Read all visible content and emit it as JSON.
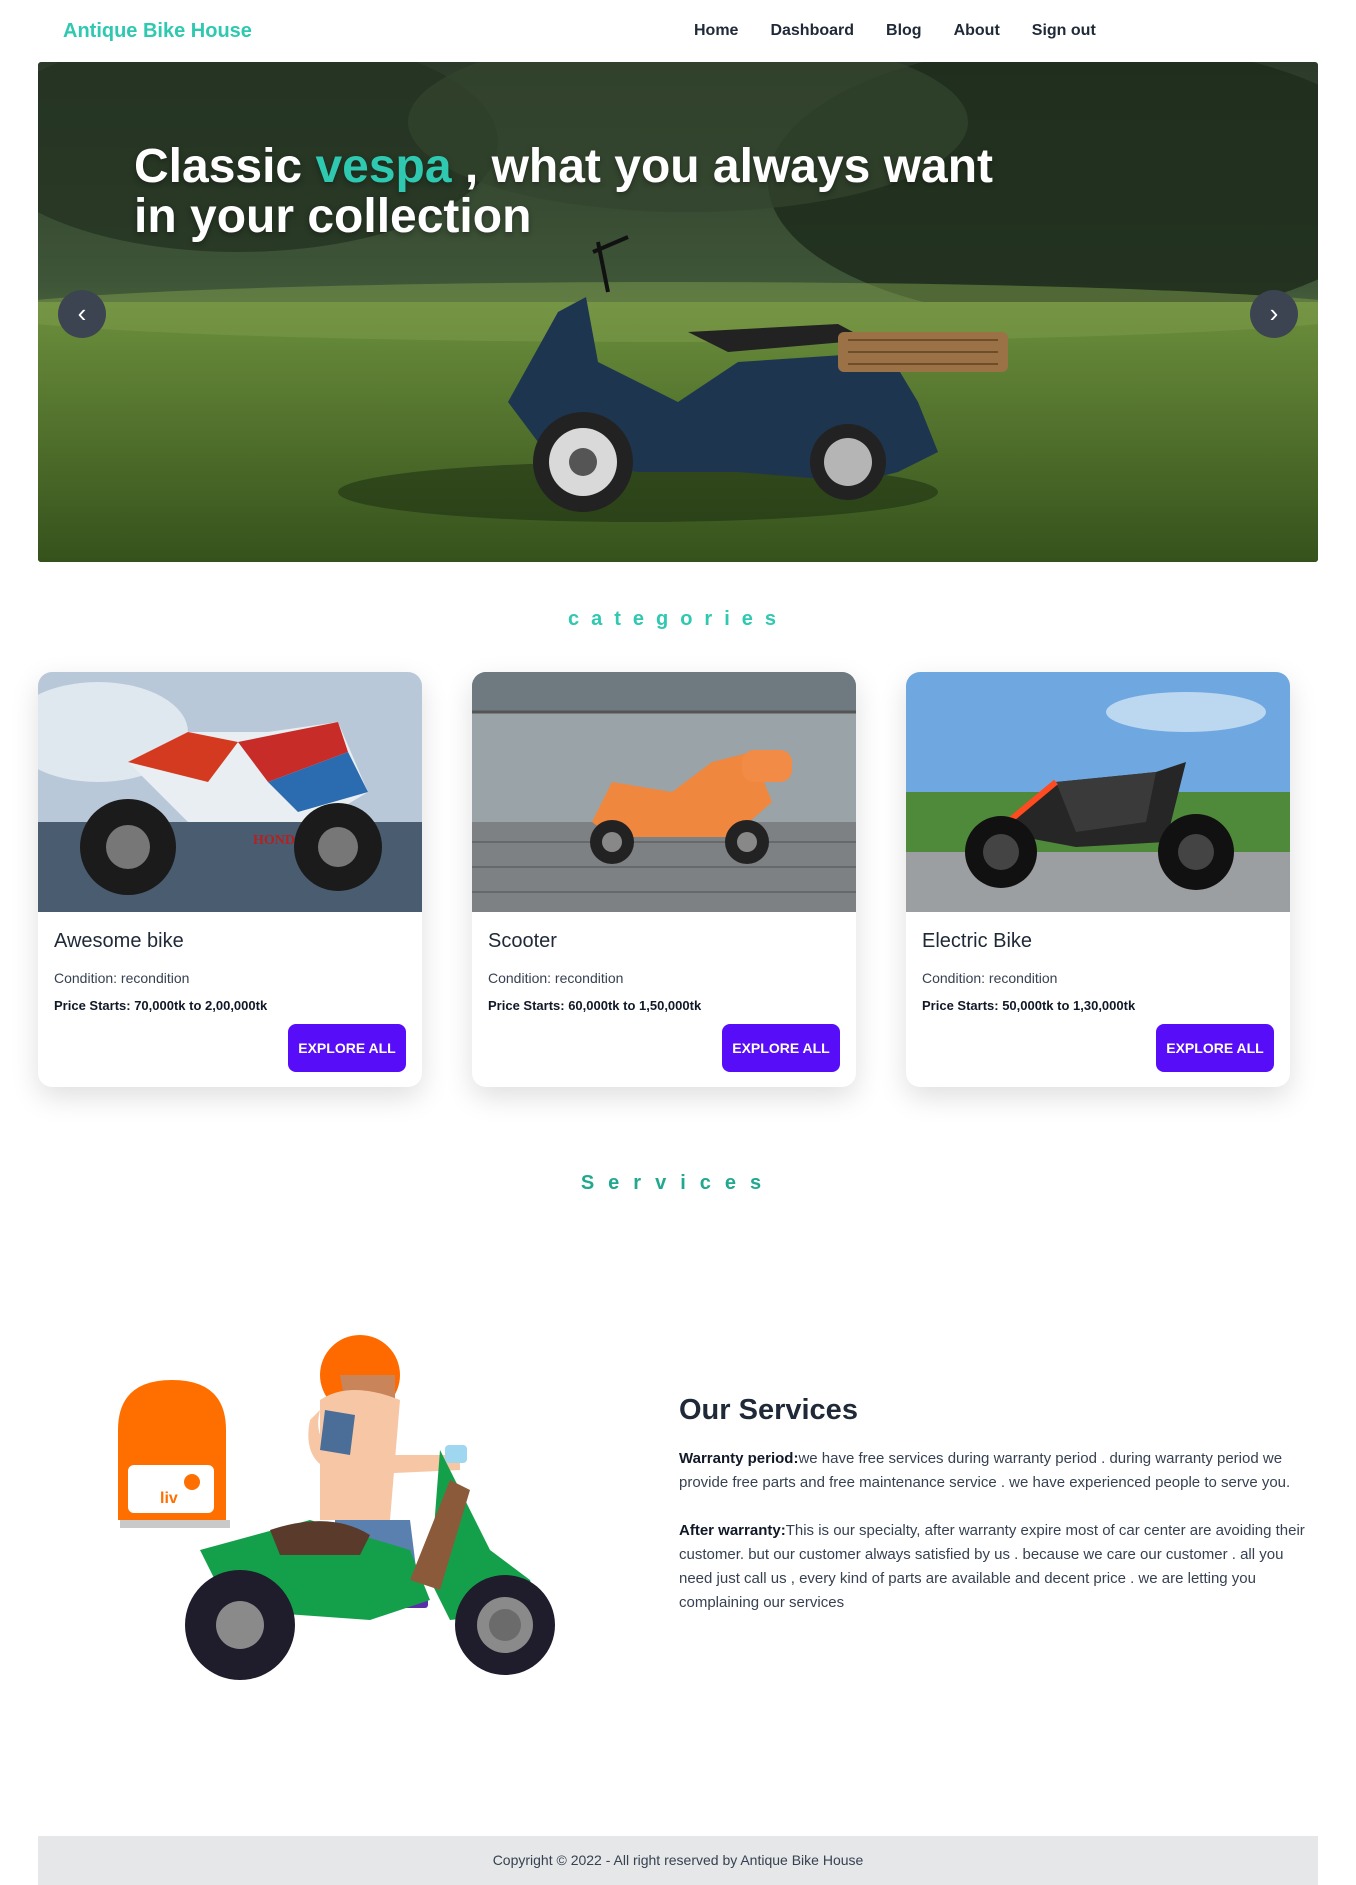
{
  "navbar": {
    "brand": "Antique Bike House",
    "links": [
      "Home",
      "Dashboard",
      "Blog",
      "About",
      "Sign out"
    ]
  },
  "hero": {
    "title_before": "Classic ",
    "title_accent": "vespa",
    "title_after": " , what you always want in your collection",
    "prev_icon": "‹",
    "next_icon": "›"
  },
  "categories": {
    "title": "categories",
    "items": [
      {
        "title": "Awesome bike",
        "condition": "Condition: recondition",
        "price_label": "Price Starts:",
        "price_value": " 70,000tk to 2,00,000tk",
        "button": "EXPLORE ALL",
        "image_icon": "sport-motorcycle-photo"
      },
      {
        "title": "Scooter",
        "condition": "Condition: recondition",
        "price_label": "Price Starts:",
        "price_value": " 60,000tk to 1,50,000tk",
        "button": "EXPLORE ALL",
        "image_icon": "orange-scooter-photo"
      },
      {
        "title": "Electric Bike",
        "condition": "Condition: recondition",
        "price_label": "Price Starts:",
        "price_value": " 50,000tk to 1,30,000tk",
        "button": "EXPLORE ALL",
        "image_icon": "electric-bike-photo"
      }
    ]
  },
  "services": {
    "title": "Services",
    "heading": "Our Services",
    "warranty_label": "Warranty period:",
    "warranty_text": "we have free services during warranty period . during warranty period we provide free parts and free maintenance service . we have experienced people to serve you.",
    "after_label": "After warranty:",
    "after_text": "This is our specialty, after warranty expire most of car center are avoiding their customer. but our customer always satisfied by us . because we care our customer . all you need just call us , every kind of parts are available and decent price . we are letting you complaining our services",
    "illustration_icon": "delivery-scooter-illustration",
    "box_label": "liv"
  },
  "footer": {
    "text": "Copyright © 2022 - All right reserved by Antique Bike House"
  },
  "colors": {
    "accent": "#2fc8b0",
    "button": "#570df8"
  }
}
